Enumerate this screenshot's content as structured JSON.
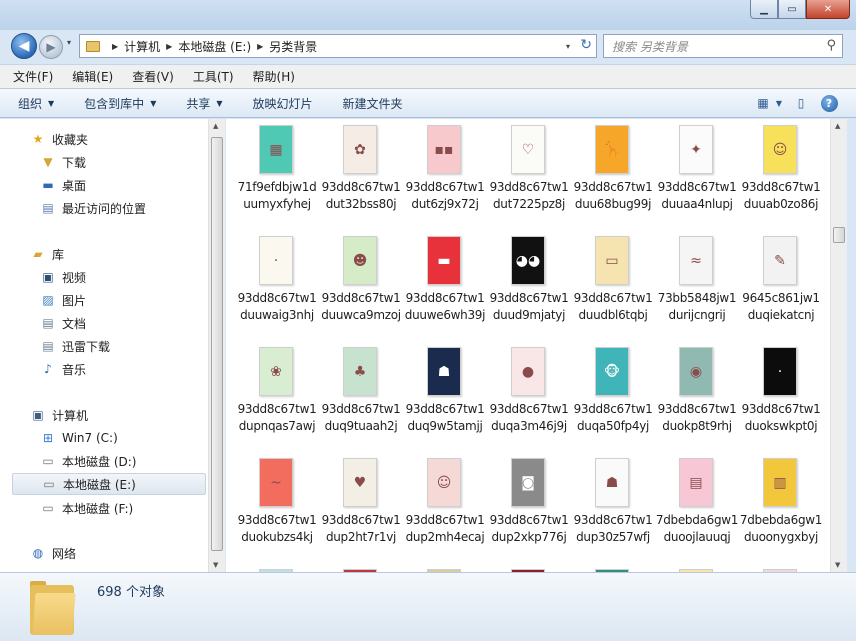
{
  "window": {
    "controls": {
      "minimize": "▁",
      "maximize": "▭",
      "close": "✕"
    }
  },
  "nav": {
    "back": "◀",
    "forward": "▶",
    "dropdown": "▾"
  },
  "address": {
    "crumbs": [
      "计算机",
      "本地磁盘 (E:)",
      "另类背景"
    ],
    "refresh": "↻"
  },
  "search": {
    "placeholder": "搜索 另类背景",
    "icon": "⚲"
  },
  "menu": [
    "文件(F)",
    "编辑(E)",
    "查看(V)",
    "工具(T)",
    "帮助(H)"
  ],
  "toolbar": {
    "organize": "组织",
    "include_in_library": "包含到库中",
    "share": "共享",
    "slideshow": "放映幻灯片",
    "new_folder": "新建文件夹",
    "help": "?"
  },
  "sidebar": {
    "favorites": "收藏夹",
    "downloads": "下载",
    "desktop": "桌面",
    "recent": "最近访问的位置",
    "libraries": "库",
    "videos": "视频",
    "pictures": "图片",
    "documents": "文档",
    "xunlei": "迅雷下载",
    "music": "音乐",
    "computer": "计算机",
    "drive_c": "Win7 (C:)",
    "drive_d": "本地磁盘 (D:)",
    "drive_e": "本地磁盘 (E:)",
    "drive_f": "本地磁盘 (F:)",
    "network": "网络"
  },
  "files": [
    {
      "name": "71f9efdbjw1duumyxfyhej",
      "color": "#4fc9b4",
      "glyph": "▦"
    },
    {
      "name": "93dd8c67tw1dut32bss80j",
      "color": "#f6ece6",
      "glyph": "✿"
    },
    {
      "name": "93dd8c67tw1dut6zj9x72j",
      "color": "#f7c9cc",
      "glyph": "▪▪"
    },
    {
      "name": "93dd8c67tw1dut7225pz8j",
      "color": "#fbfbf8",
      "glyph": "♡"
    },
    {
      "name": "93dd8c67tw1duu68bug99j",
      "color": "#f6a72a",
      "glyph": "🦒"
    },
    {
      "name": "93dd8c67tw1duuaa4nlupj",
      "color": "#fbfbfb",
      "glyph": "✦"
    },
    {
      "name": "93dd8c67tw1duuab0zo86j",
      "color": "#f7e05a",
      "glyph": "☺"
    },
    {
      "name": "93dd8c67tw1duuwaig3nhj",
      "color": "#fbf9ef",
      "glyph": "·"
    },
    {
      "name": "93dd8c67tw1duuwca9mzoj",
      "color": "#d6ecc9",
      "glyph": "☻"
    },
    {
      "name": "93dd8c67tw1duuwe6wh39j",
      "color": "#e8323b",
      "glyph": "▬"
    },
    {
      "name": "93dd8c67tw1duud9mjatyj",
      "color": "#111111",
      "glyph": "◕◕"
    },
    {
      "name": "93dd8c67tw1duudbl6tqbj",
      "color": "#f6e4b0",
      "glyph": "▭"
    },
    {
      "name": "73bb5848jw1durijcngrij",
      "color": "#f5f5f5",
      "glyph": "≈"
    },
    {
      "name": "9645c861jw1duqiekatcnj",
      "color": "#f2f2f2",
      "glyph": "✎"
    },
    {
      "name": "93dd8c67tw1dupnqas7awj",
      "color": "#d9edd2",
      "glyph": "❀"
    },
    {
      "name": "93dd8c67tw1duq9tuaah2j",
      "color": "#c7e3cf",
      "glyph": "♣"
    },
    {
      "name": "93dd8c67tw1duq9w5tamjj",
      "color": "#1a2b4e",
      "glyph": "☗"
    },
    {
      "name": "93dd8c67tw1duqa3m46j9j",
      "color": "#f9e7e7",
      "glyph": "●"
    },
    {
      "name": "93dd8c67tw1duqa50fp4yj",
      "color": "#3fb5b9",
      "glyph": "🐵"
    },
    {
      "name": "93dd8c67tw1duokp8t9rhj",
      "color": "#8fb9b1",
      "glyph": "◉"
    },
    {
      "name": "93dd8c67tw1duokswkpt0j",
      "color": "#0c0c0c",
      "glyph": "·"
    },
    {
      "name": "93dd8c67tw1duokubzs4kj",
      "color": "#f26d5e",
      "glyph": "~"
    },
    {
      "name": "93dd8c67tw1dup2ht7r1vj",
      "color": "#f3efe4",
      "glyph": "♥"
    },
    {
      "name": "93dd8c67tw1dup2mh4ecaj",
      "color": "#f5d9d6",
      "glyph": "☺"
    },
    {
      "name": "93dd8c67tw1dup2xkp776j",
      "color": "#8a8a8a",
      "glyph": "◙"
    },
    {
      "name": "93dd8c67tw1dup30z57wfj",
      "color": "#fafafa",
      "glyph": "☗"
    },
    {
      "name": "7dbebda6gw1duoojlauuqj",
      "color": "#f7c7d6",
      "glyph": "▤"
    },
    {
      "name": "7dbebda6gw1duoonygxbyj",
      "color": "#f2c73b",
      "glyph": "▥"
    }
  ],
  "status": {
    "count": "698 个对象"
  }
}
